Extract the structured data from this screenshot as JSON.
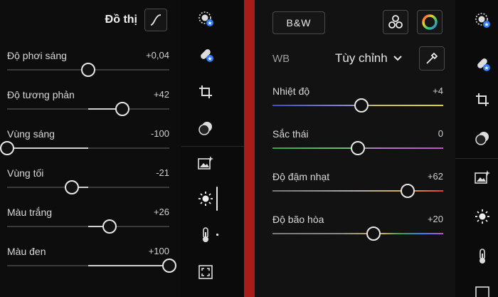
{
  "left_panel": {
    "header_title": "Đồ thị",
    "sliders": [
      {
        "label": "Độ phơi sáng",
        "value": "+0,04",
        "position": 0.5,
        "mode": "center"
      },
      {
        "label": "Độ tương phản",
        "value": "+42",
        "position": 0.71,
        "mode": "center"
      },
      {
        "label": "Vùng sáng",
        "value": "-100",
        "position": 0.0,
        "mode": "center"
      },
      {
        "label": "Vùng tối",
        "value": "-21",
        "position": 0.4,
        "mode": "center"
      },
      {
        "label": "Màu trắng",
        "value": "+26",
        "position": 0.63,
        "mode": "center"
      },
      {
        "label": "Màu đen",
        "value": "+100",
        "position": 1.0,
        "mode": "center"
      }
    ]
  },
  "right_panel": {
    "bw_label": "B&W",
    "wb_label": "WB",
    "wb_value": "Tùy chỉnh",
    "sliders": [
      {
        "label": "Nhiệt độ",
        "value": "+4",
        "position": 0.52,
        "gradient": "temp"
      },
      {
        "label": "Sắc thái",
        "value": "0",
        "position": 0.5,
        "gradient": "tint"
      },
      {
        "label": "Độ đậm nhạt",
        "value": "+62",
        "position": 0.79,
        "gradient": "vibrance"
      },
      {
        "label": "Độ bão hòa",
        "value": "+20",
        "position": 0.59,
        "gradient": "saturation"
      }
    ]
  },
  "rail_icons": [
    "masking-icon",
    "healing-icon",
    "crop-icon",
    "presets-icon",
    "edit-image-icon",
    "light-icon",
    "color-temperature-icon",
    "frame-icon"
  ],
  "colors": {
    "divider": "#a81d1a",
    "accent_badge": "#2e7cf6"
  }
}
